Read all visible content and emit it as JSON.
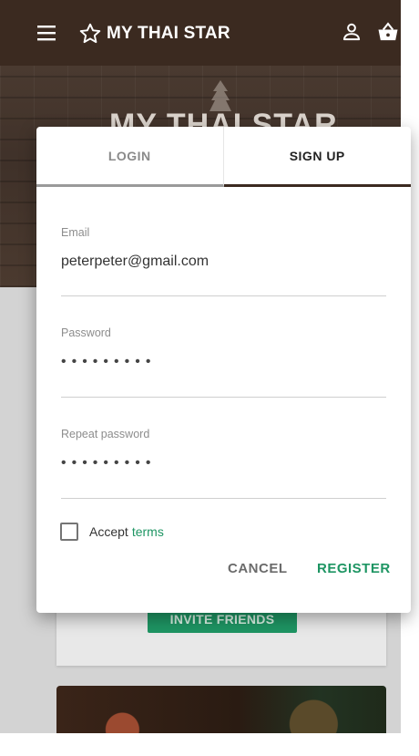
{
  "toolbar": {
    "brand": "MY THAI STAR",
    "icons": [
      "menu-icon",
      "star-outline-icon",
      "user-icon",
      "shopping-basket-icon"
    ]
  },
  "hero": {
    "title": "MY THAI STAR"
  },
  "dialog": {
    "tabs": [
      {
        "label": "LOGIN",
        "active": false
      },
      {
        "label": "SIGN UP",
        "active": true
      }
    ],
    "fields": {
      "email": {
        "label": "Email",
        "value": "peterpeter@gmail.com"
      },
      "password": {
        "label": "Password",
        "value": "•••••••••"
      },
      "repeat_password": {
        "label": "Repeat password",
        "value": "•••••••••"
      }
    },
    "accept": {
      "text": "Accept",
      "link": "terms",
      "checked": false
    },
    "buttons": {
      "cancel": "CANCEL",
      "register": "REGISTER"
    }
  },
  "background": {
    "invite_button": "INVITE FRIENDS"
  },
  "colors": {
    "toolbar": "#3b2a20",
    "accent": "#1e9563",
    "dialog": "#ffffff",
    "backdrop": "#d3d3d3"
  }
}
